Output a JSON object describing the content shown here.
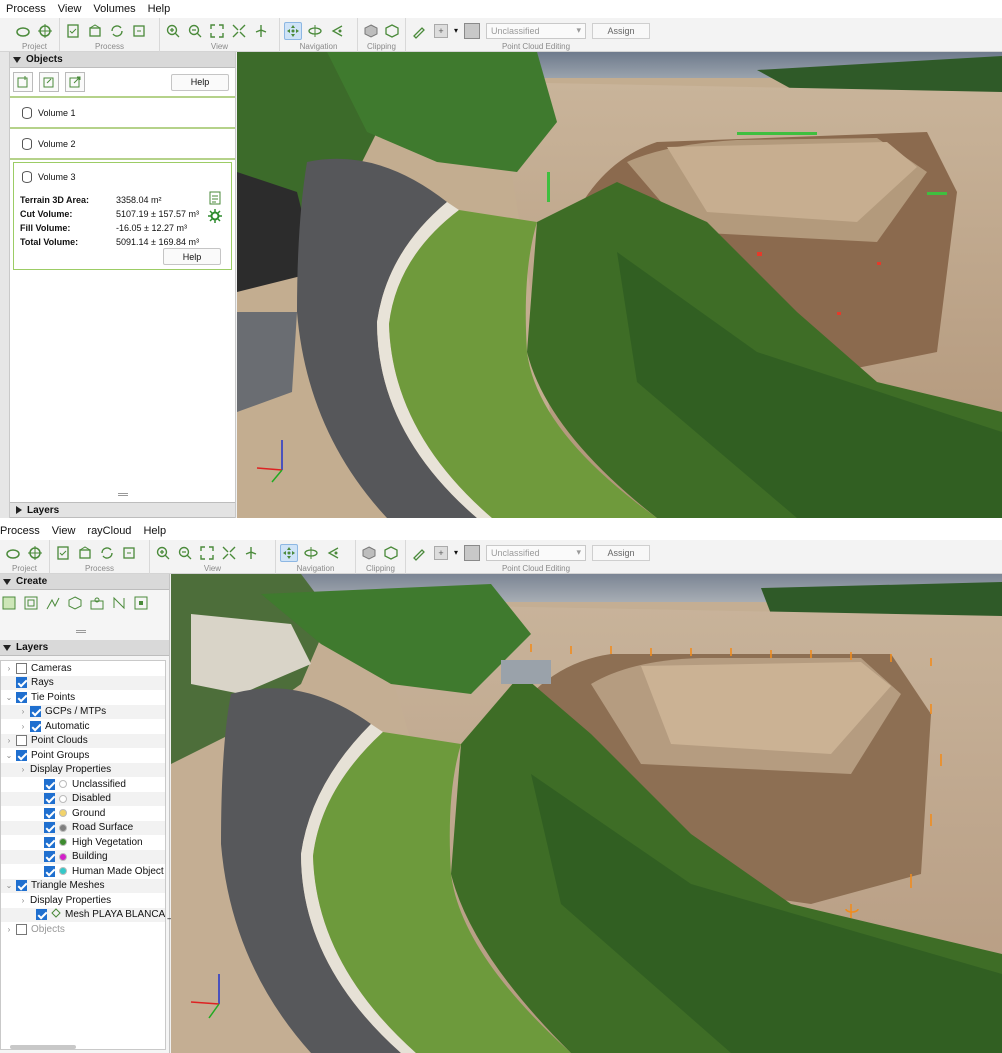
{
  "screen1": {
    "menu": [
      "Process",
      "View",
      "Volumes",
      "Help"
    ],
    "toolbar": {
      "groups": [
        "Project",
        "Process",
        "View",
        "Navigation",
        "Clipping",
        "Point Cloud Editing"
      ],
      "class_select": "Unclassified",
      "assign_label": "Assign"
    },
    "objects_header": "Objects",
    "help_label": "Help",
    "volumes": [
      "Volume 1",
      "Volume 2",
      "Volume 3"
    ],
    "volume_details": {
      "terrain_label": "Terrain 3D Area:",
      "terrain_value": "3358.04 m²",
      "cut_label": "Cut Volume:",
      "cut_value": "5107.19 ± 157.57 m³",
      "fill_label": "Fill Volume:",
      "fill_value": "-16.05 ± 12.27 m³",
      "total_label": "Total Volume:",
      "total_value": "5091.14 ± 169.84 m³",
      "help_label": "Help"
    },
    "layers_header": "Layers"
  },
  "screen2": {
    "menu": [
      "Process",
      "View",
      "rayCloud",
      "Help"
    ],
    "toolbar": {
      "groups": [
        "Project",
        "Process",
        "View",
        "Navigation",
        "Clipping",
        "Point Cloud Editing"
      ],
      "class_select": "Unclassified",
      "assign_label": "Assign"
    },
    "create_header": "Create",
    "layers_header": "Layers",
    "layers": [
      {
        "label": "Cameras",
        "indent": 0,
        "chevron": true,
        "checked": false
      },
      {
        "label": "Rays",
        "indent": 0,
        "chevron": false,
        "checked": true
      },
      {
        "label": "Tie Points",
        "indent": 0,
        "chevron": true,
        "checked": true,
        "open": true
      },
      {
        "label": "GCPs / MTPs",
        "indent": 1,
        "chevron": true,
        "checked": true
      },
      {
        "label": "Automatic",
        "indent": 1,
        "chevron": true,
        "checked": true
      },
      {
        "label": "Point Clouds",
        "indent": 0,
        "chevron": true,
        "checked": false
      },
      {
        "label": "Point Groups",
        "indent": 0,
        "chevron": true,
        "checked": true,
        "open": true
      },
      {
        "label": "Display Properties",
        "indent": 1,
        "chevron": true,
        "nocheck": true
      },
      {
        "label": "Unclassified",
        "indent": 2,
        "checked": true,
        "color": "#ffffff"
      },
      {
        "label": "Disabled",
        "indent": 2,
        "checked": true,
        "color": "#ffffff"
      },
      {
        "label": "Ground",
        "indent": 2,
        "checked": true,
        "color": "#f2d36b"
      },
      {
        "label": "Road Surface",
        "indent": 2,
        "checked": true,
        "color": "#7f7f7f"
      },
      {
        "label": "High Vegetation",
        "indent": 2,
        "checked": true,
        "color": "#3d8b2f"
      },
      {
        "label": "Building",
        "indent": 2,
        "checked": true,
        "color": "#d21ec8"
      },
      {
        "label": "Human Made Object",
        "indent": 2,
        "checked": true,
        "color": "#35c8c8"
      },
      {
        "label": "Triangle Meshes",
        "indent": 0,
        "chevron": true,
        "checked": true,
        "open": true
      },
      {
        "label": "Display Properties",
        "indent": 1,
        "chevron": true,
        "nocheck": true
      },
      {
        "label": "Mesh PLAYA BLANCA _s",
        "indent": 2,
        "checked": true,
        "mesh": true
      },
      {
        "label": "Objects",
        "indent": 0,
        "chevron": true,
        "checked": false,
        "muted": true
      }
    ]
  },
  "colors": {
    "accent_green": "#9ccc65",
    "selection_blue": "#1f6fcf"
  }
}
